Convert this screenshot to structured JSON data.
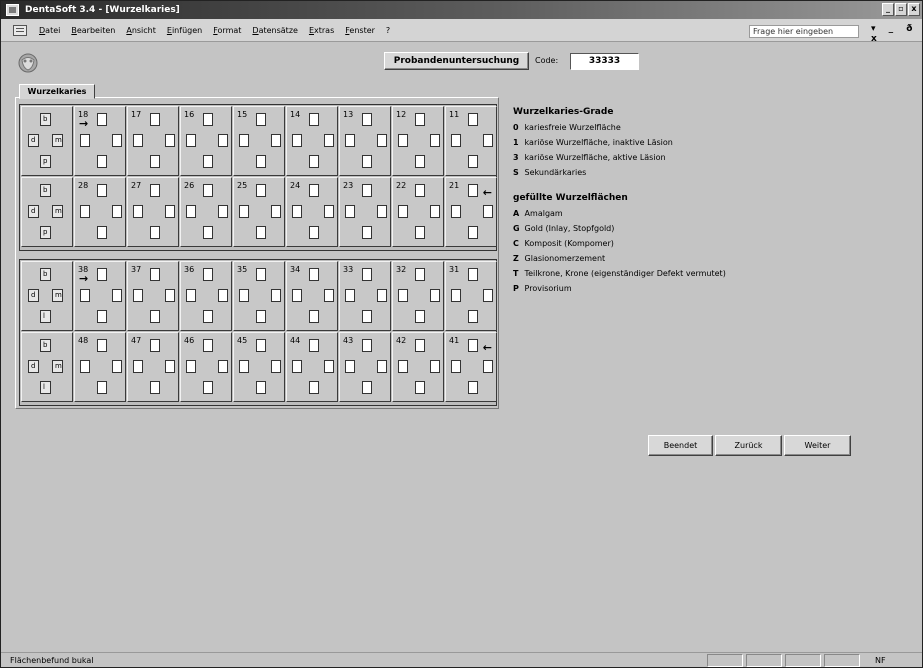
{
  "window": {
    "title": "DentaSoft 3.4 - [Wurzelkaries]",
    "controls": [
      "_",
      "▫",
      "x"
    ]
  },
  "menu": {
    "items": [
      "Datei",
      "Bearbeiten",
      "Ansicht",
      "Einfügen",
      "Format",
      "Datensätze",
      "Extras",
      "Fenster",
      "?"
    ],
    "help_placeholder": "Frage hier eingeben",
    "doc_controls": "▾ _ ð x"
  },
  "header": {
    "button_label": "Probandenuntersuchung",
    "code_label": "Code:",
    "code_value": "33333"
  },
  "tab": {
    "label": "Wurzelkaries"
  },
  "legend_cells": {
    "upper": {
      "top": "b",
      "left": "d",
      "right": "m",
      "bottom": "p"
    },
    "lower": {
      "top": "b",
      "left": "d",
      "right": "m",
      "bottom": "l"
    }
  },
  "teeth": {
    "row1": [
      "18",
      "17",
      "16",
      "15",
      "14",
      "13",
      "12",
      "11"
    ],
    "row2": [
      "28",
      "27",
      "26",
      "25",
      "24",
      "23",
      "22",
      "21"
    ],
    "row3": [
      "38",
      "37",
      "36",
      "35",
      "34",
      "33",
      "32",
      "31"
    ],
    "row4": [
      "48",
      "47",
      "46",
      "45",
      "44",
      "43",
      "42",
      "41"
    ]
  },
  "arrows": {
    "right": "→",
    "left": "←"
  },
  "grades": {
    "heading": "Wurzelkaries-Grade",
    "items": [
      {
        "key": "0",
        "text": "kariesfreie Wurzelfläche"
      },
      {
        "key": "1",
        "text": "kariöse Wurzelfläche, inaktive Läsion"
      },
      {
        "key": "3",
        "text": "kariöse Wurzelfläche, aktive Läsion"
      },
      {
        "key": "S",
        "text": "Sekundärkaries"
      }
    ]
  },
  "filled": {
    "heading": "gefüllte Wurzelflächen",
    "items": [
      {
        "key": "A",
        "text": "Amalgam"
      },
      {
        "key": "G",
        "text": "Gold (Inlay, Stopfgold)"
      },
      {
        "key": "C",
        "text": "Komposit (Kompomer)"
      },
      {
        "key": "Z",
        "text": "Glasionomerzement"
      },
      {
        "key": "T",
        "text": "Teilkrone, Krone (eigenständiger Defekt vermutet)"
      },
      {
        "key": "P",
        "text": "Provisorium"
      }
    ]
  },
  "nav": {
    "beendet": "Beendet",
    "zurueck": "Zurück",
    "weiter": "Weiter"
  },
  "status": {
    "text": "Flächenbefund bukal",
    "mode": "NF"
  }
}
